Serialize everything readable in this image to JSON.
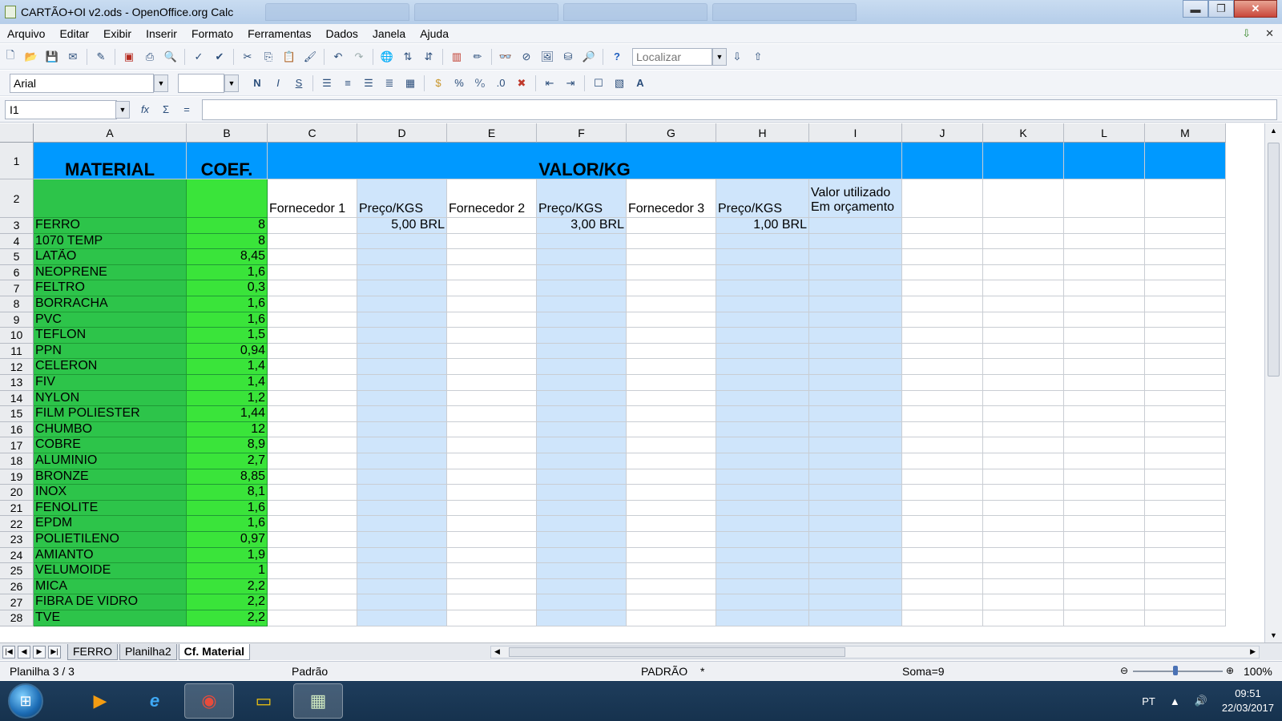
{
  "window": {
    "title": "CARTÃO+OI v2.ods - OpenOffice.org Calc",
    "minimize": "▬",
    "maximize": "❐",
    "close": "✕"
  },
  "menu": [
    "Arquivo",
    "Editar",
    "Exibir",
    "Inserir",
    "Formato",
    "Ferramentas",
    "Dados",
    "Janela",
    "Ajuda"
  ],
  "toolbar": {
    "find_placeholder": "Localizar",
    "font_name": "Arial",
    "font_size": "",
    "bold": "N",
    "italic": "I",
    "underline": "S"
  },
  "formula_bar": {
    "cell_ref": "I1",
    "fx": "fx",
    "sum": "Σ",
    "equals": "=",
    "content": ""
  },
  "columns": [
    "A",
    "B",
    "C",
    "D",
    "E",
    "F",
    "G",
    "H",
    "I",
    "J",
    "K",
    "L",
    "M"
  ],
  "header_row1": {
    "material": "MATERIAL",
    "coef": "COEF.",
    "valor": "VALOR/KG"
  },
  "header_row2": {
    "c": "Fornecedor 1",
    "d": "Preço/KGS",
    "e": "Fornecedor 2",
    "f": "Preço/KGS",
    "g": "Fornecedor 3",
    "h": "Preço/KGS",
    "i_line1": "Valor utilizado",
    "i_line2": "Em orçamento"
  },
  "rows": [
    {
      "num": "3",
      "material": "FERRO",
      "coef": "8",
      "d": "5,00 BRL",
      "f": "3,00 BRL",
      "h": "1,00 BRL"
    },
    {
      "num": "4",
      "material": "1070 TEMP",
      "coef": "8"
    },
    {
      "num": "5",
      "material": "LATÃO",
      "coef": "8,45"
    },
    {
      "num": "6",
      "material": "NEOPRENE",
      "coef": "1,6"
    },
    {
      "num": "7",
      "material": "FELTRO",
      "coef": "0,3"
    },
    {
      "num": "8",
      "material": "BORRACHA",
      "coef": "1,6"
    },
    {
      "num": "9",
      "material": "PVC",
      "coef": "1,6"
    },
    {
      "num": "10",
      "material": "TEFLON",
      "coef": "1,5"
    },
    {
      "num": "11",
      "material": "PPN",
      "coef": "0,94"
    },
    {
      "num": "12",
      "material": "CELERON",
      "coef": "1,4"
    },
    {
      "num": "13",
      "material": "FIV",
      "coef": "1,4"
    },
    {
      "num": "14",
      "material": "NYLON",
      "coef": "1,2"
    },
    {
      "num": "15",
      "material": "FILM POLIESTER",
      "coef": "1,44"
    },
    {
      "num": "16",
      "material": "CHUMBO",
      "coef": "12"
    },
    {
      "num": "17",
      "material": "COBRE",
      "coef": "8,9"
    },
    {
      "num": "18",
      "material": "ALUMINIO",
      "coef": "2,7"
    },
    {
      "num": "19",
      "material": "BRONZE",
      "coef": "8,85"
    },
    {
      "num": "20",
      "material": "INOX",
      "coef": "8,1"
    },
    {
      "num": "21",
      "material": "FENOLITE",
      "coef": "1,6"
    },
    {
      "num": "22",
      "material": "EPDM",
      "coef": "1,6"
    },
    {
      "num": "23",
      "material": "POLIETILENO",
      "coef": "0,97"
    },
    {
      "num": "24",
      "material": "AMIANTO",
      "coef": "1,9"
    },
    {
      "num": "25",
      "material": "VELUMOIDE",
      "coef": "1"
    },
    {
      "num": "26",
      "material": "MICA",
      "coef": "2,2"
    },
    {
      "num": "27",
      "material": "FIBRA DE VIDRO",
      "coef": "2,2"
    },
    {
      "num": "28",
      "material": "TVE",
      "coef": "2,2"
    }
  ],
  "sheet_tabs": [
    "FERRO",
    "Planilha2",
    "Cf. Material"
  ],
  "active_tab": "Cf. Material",
  "status": {
    "sheet": "Planilha 3 / 3",
    "style": "Padrão",
    "mode": "PADRÃO",
    "modified": "*",
    "sum": "Soma=9",
    "zoom": "100%"
  },
  "taskbar": {
    "lang": "PT",
    "time": "09:51",
    "date": "22/03/2017"
  },
  "colors": {
    "header_blue": "#0099ff",
    "material_green": "#2dc44a",
    "coef_green": "#3ae43a",
    "price_col_blue": "#cfe5fb"
  }
}
